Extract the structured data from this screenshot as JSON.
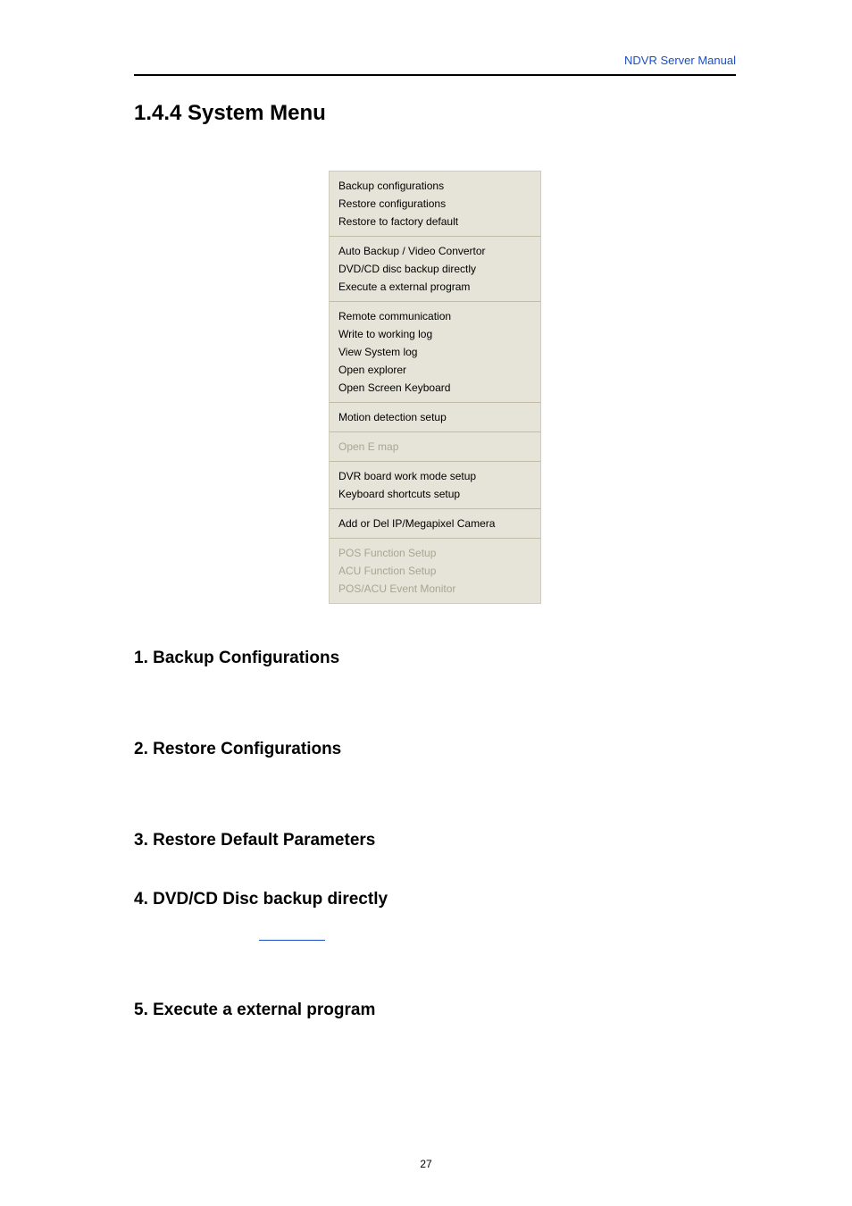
{
  "header": {
    "link_text": "NDVR Server Manual"
  },
  "section_heading": "1.4.4 System Menu",
  "menu": {
    "groups": [
      {
        "items": [
          {
            "label": "Backup configurations",
            "disabled": false
          },
          {
            "label": "Restore configurations",
            "disabled": false
          },
          {
            "label": "Restore to factory default",
            "disabled": false
          }
        ]
      },
      {
        "items": [
          {
            "label": "Auto Backup / Video Convertor",
            "disabled": false
          },
          {
            "label": "DVD/CD disc backup directly",
            "disabled": false
          },
          {
            "label": "Execute a  external  program",
            "disabled": false
          }
        ]
      },
      {
        "items": [
          {
            "label": "Remote communication",
            "disabled": false
          },
          {
            "label": "Write to working log",
            "disabled": false
          },
          {
            "label": "View System log",
            "disabled": false
          },
          {
            "label": "Open explorer",
            "disabled": false
          },
          {
            "label": "Open Screen Keyboard",
            "disabled": false
          }
        ]
      },
      {
        "items": [
          {
            "label": "Motion detection setup",
            "disabled": false
          }
        ]
      },
      {
        "items": [
          {
            "label": "Open E map",
            "disabled": true
          }
        ]
      },
      {
        "items": [
          {
            "label": "DVR board work mode setup",
            "disabled": false
          },
          {
            "label": "Keyboard shortcuts setup",
            "disabled": false
          }
        ]
      },
      {
        "items": [
          {
            "label": "Add or Del IP/Megapixel Camera",
            "disabled": false
          }
        ]
      },
      {
        "items": [
          {
            "label": "POS Function Setup",
            "disabled": true
          },
          {
            "label": "ACU Function Setup",
            "disabled": true
          },
          {
            "label": "POS/ACU Event Monitor",
            "disabled": true
          }
        ]
      }
    ]
  },
  "subsections": [
    {
      "label": "1. Backup Configurations"
    },
    {
      "label": "2. Restore Configurations"
    },
    {
      "label": "3. Restore Default Parameters"
    },
    {
      "label": "4. DVD/CD Disc backup directly"
    },
    {
      "label": "5. Execute a external program"
    }
  ],
  "page_number": "27"
}
